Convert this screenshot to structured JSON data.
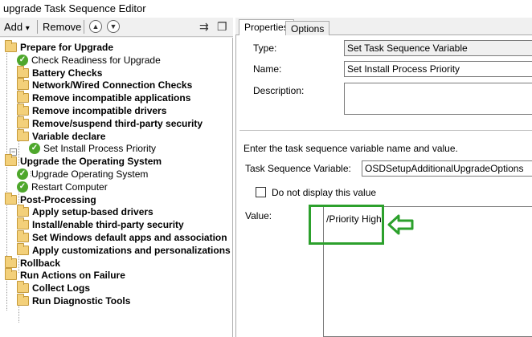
{
  "window": {
    "title": "upgrade Task Sequence Editor"
  },
  "toolbar": {
    "add_label": "Add",
    "add_arrow": "▾",
    "remove_label": "Remove"
  },
  "tree": [
    {
      "label": "Prepare for Upgrade",
      "icon": "folder",
      "bold": true,
      "level": 0
    },
    {
      "label": "Check Readiness for Upgrade",
      "icon": "check",
      "bold": false,
      "level": 1
    },
    {
      "label": "Battery Checks",
      "icon": "folder",
      "bold": true,
      "level": 1
    },
    {
      "label": "Network/Wired Connection Checks",
      "icon": "folder",
      "bold": true,
      "level": 1
    },
    {
      "label": "Remove incompatible applications",
      "icon": "folder",
      "bold": true,
      "level": 1
    },
    {
      "label": "Remove incompatible drivers",
      "icon": "folder",
      "bold": true,
      "level": 1
    },
    {
      "label": "Remove/suspend third-party security",
      "icon": "folder",
      "bold": true,
      "level": 1
    },
    {
      "label": "Variable declare",
      "icon": "folder",
      "bold": true,
      "level": 1
    },
    {
      "label": "Set Install Process Priority",
      "icon": "check",
      "bold": false,
      "level": 2
    },
    {
      "label": "Upgrade the Operating System",
      "icon": "folder",
      "bold": true,
      "level": 0
    },
    {
      "label": "Upgrade Operating System",
      "icon": "check",
      "bold": false,
      "level": 1
    },
    {
      "label": "Restart Computer",
      "icon": "check",
      "bold": false,
      "level": 1
    },
    {
      "label": "Post-Processing",
      "icon": "folder",
      "bold": true,
      "level": 0
    },
    {
      "label": "Apply setup-based drivers",
      "icon": "folder",
      "bold": true,
      "level": 1
    },
    {
      "label": "Install/enable third-party security",
      "icon": "folder",
      "bold": true,
      "level": 1
    },
    {
      "label": "Set Windows default apps and association",
      "icon": "folder",
      "bold": true,
      "level": 1
    },
    {
      "label": "Apply customizations and personalizations",
      "icon": "folder",
      "bold": true,
      "level": 1
    },
    {
      "label": "Rollback",
      "icon": "folder",
      "bold": true,
      "level": 0
    },
    {
      "label": "Run Actions on Failure",
      "icon": "folder",
      "bold": true,
      "level": 0
    },
    {
      "label": "Collect Logs",
      "icon": "folder",
      "bold": true,
      "level": 1
    },
    {
      "label": "Run Diagnostic Tools",
      "icon": "folder",
      "bold": true,
      "level": 1
    }
  ],
  "tabs": {
    "properties": "Properties",
    "options": "Options"
  },
  "properties": {
    "type_label": "Type:",
    "type_value": "Set Task Sequence Variable",
    "name_label": "Name:",
    "name_value": "Set Install Process Priority",
    "description_label": "Description:",
    "instructions": "Enter the task sequence variable name and value.",
    "variable_label": "Task Sequence Variable:",
    "variable_value": "OSDSetupAdditionalUpgradeOptions",
    "hide_checkbox_label": "Do not display this value",
    "value_label": "Value:",
    "value_text": "/Priority High"
  },
  "colors": {
    "highlight": "#2ca02c",
    "check": "#4ea72c",
    "folder": "#f3d07a"
  }
}
